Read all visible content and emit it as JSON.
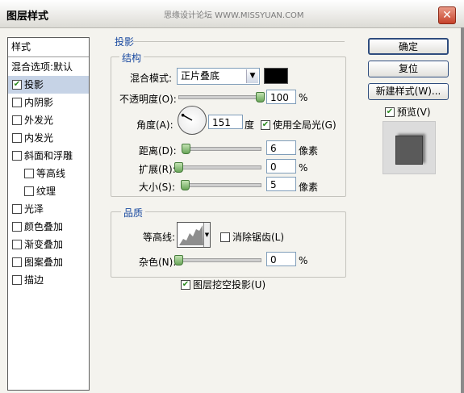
{
  "window": {
    "title": "图层样式",
    "watermark": "思缘设计论坛  WWW.MISSYUAN.COM",
    "close_label": "✕"
  },
  "sidebar": {
    "header": "样式",
    "blend_options": "混合选项:默认",
    "items": [
      {
        "label": "投影",
        "checked": true,
        "selected": true,
        "indent": false
      },
      {
        "label": "内阴影",
        "checked": false,
        "indent": false
      },
      {
        "label": "外发光",
        "checked": false,
        "indent": false
      },
      {
        "label": "内发光",
        "checked": false,
        "indent": false
      },
      {
        "label": "斜面和浮雕",
        "checked": false,
        "indent": false
      },
      {
        "label": "等高线",
        "checked": false,
        "indent": true
      },
      {
        "label": "纹理",
        "checked": false,
        "indent": true
      },
      {
        "label": "光泽",
        "checked": false,
        "indent": false
      },
      {
        "label": "颜色叠加",
        "checked": false,
        "indent": false
      },
      {
        "label": "渐变叠加",
        "checked": false,
        "indent": false
      },
      {
        "label": "图案叠加",
        "checked": false,
        "indent": false
      },
      {
        "label": "描边",
        "checked": false,
        "indent": false
      }
    ]
  },
  "shadow": {
    "section_title": "投影",
    "structure": {
      "title": "结构",
      "blend_mode_label": "混合模式:",
      "blend_mode_value": "正片叠底",
      "swatch_color": "#000000",
      "opacity_label": "不透明度(O):",
      "opacity_value": "100",
      "opacity_unit": "%",
      "opacity_level": 1.0,
      "angle_label": "角度(A):",
      "angle_value": "151",
      "angle_unit": "度",
      "global_light_label": "使用全局光(G)",
      "global_light_checked": true,
      "distance_label": "距离(D):",
      "distance_value": "6",
      "distance_unit": "像素",
      "distance_level": 0.05,
      "spread_label": "扩展(R):",
      "spread_value": "0",
      "spread_unit": "%",
      "spread_level": 0.0,
      "size_label": "大小(S):",
      "size_value": "5",
      "size_unit": "像素",
      "size_level": 0.04
    },
    "quality": {
      "title": "品质",
      "contour_label": "等高线:",
      "anti_alias_label": "消除锯齿(L)",
      "anti_alias_checked": false,
      "noise_label": "杂色(N):",
      "noise_value": "0",
      "noise_unit": "%",
      "noise_level": 0.0
    },
    "knockout_label": "图层挖空投影(U)",
    "knockout_checked": true
  },
  "buttons": {
    "ok": "确定",
    "reset": "复位",
    "new_style": "新建样式(W)...",
    "preview_label": "预览(V)",
    "preview_checked": true
  },
  "colors": {
    "accent": "#1a4aa0",
    "selection": "#c6d3e6",
    "check": "#2a8a1e"
  }
}
